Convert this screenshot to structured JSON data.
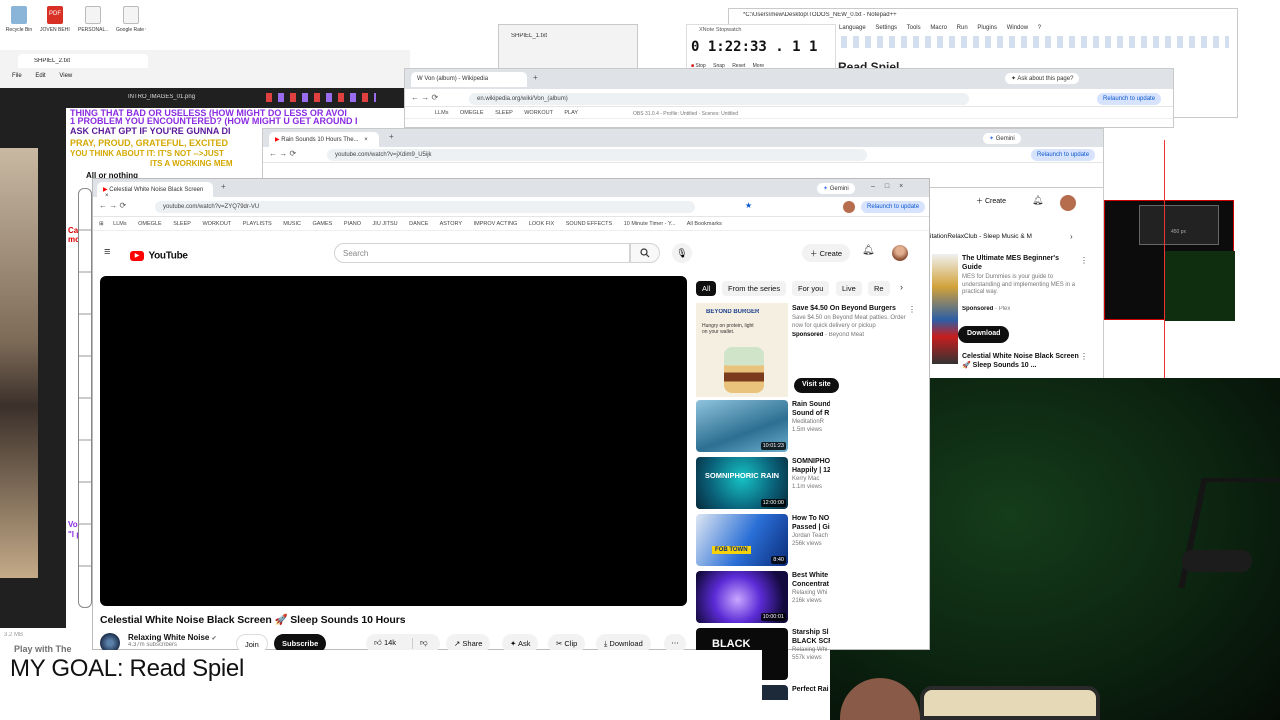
{
  "desktop": {
    "icons": [
      "Recycle Bin",
      "JOVEN BEHIND...",
      "PERSONAL...",
      "Google Rate Changelo..."
    ]
  },
  "notepad_plusplus": {
    "title": "*C:\\Users\\mew\\Desktop\\TODOS_NEW_0.txt - Notepad++",
    "menus": [
      "Language",
      "Settings",
      "Tools",
      "Macro",
      "Run",
      "Plugins",
      "Window",
      "?"
    ]
  },
  "stopwatch": {
    "title": "XNote Stopwatch",
    "time": "0 1:22:33 . 1 1",
    "buttons": [
      "Stop",
      "Snap",
      "Reset",
      "More"
    ],
    "caption": "Read Spiel"
  },
  "notepad_small": {
    "tab": "SHPIEL_1.txt",
    "menus": [
      "File",
      "Edit",
      "View"
    ]
  },
  "left_notepad": {
    "tab": "SHPIEL_2.txt",
    "menus": [
      "File",
      "Edit",
      "View"
    ],
    "status": "3.2 MB"
  },
  "image_viewer": {
    "filename": "INTRO_IMAGES_01.png",
    "lines": [
      "THING THAT BAD OR USELESS (HOW MIGHT DO LESS OR AVOI",
      "1 PROBLEM YOU ENCOUNTERED? (HOW MIGHT U GET AROUND I",
      "ASK CHAT GPT IF YOU'RE GUNNA DI",
      "PRAY, PROUD, GRATEFUL, EXCITED",
      "YOU THINK ABOUT IT: IT'S NOT -->JUST",
      "ITS A WORKING MEM"
    ],
    "all_or_nothing": "All or nothing",
    "side_fragments": [
      "Ca",
      "mc",
      "Voic",
      "\"I pre"
    ]
  },
  "wiki_window": {
    "tab": "Von (album) - Wikipedia",
    "url": "en.wikipedia.org/wiki/Von_(album)",
    "relaunch": "Relaunch to update",
    "ask": "Ask about this page?",
    "bookmarks": [
      "LLMs",
      "OMEGLE",
      "SLEEP",
      "WORKOUT",
      "PLAY"
    ],
    "obs_title": "OBS 31.0.4 - Profile: Untitled - Scenes: Untitled"
  },
  "rain_window": {
    "tab": "Rain Sounds 10 Hours The...",
    "url": "youtube.com/watch?v=jXdim9_U5ijk",
    "gemini": "Gemini",
    "relaunch": "Relaunch to update"
  },
  "right_youtube": {
    "create": "Create",
    "channel": "itationRelaxClub - Sleep Music & M",
    "ad_title": "The Ultimate MES Beginner's Guide",
    "ad_desc": "MES for Dummies is your guide to understanding and implementing MES in a practical way.",
    "ad_sponsor": "Sponsored",
    "ad_brand": "Plex",
    "download": "Download",
    "video_title": "Celestial White Noise Black Screen 🚀 Sleep Sounds 10 ...",
    "px_label": "450 px"
  },
  "main_window": {
    "tab": "Celestial White Noise Black Screen",
    "url": "youtube.com/watch?v=ZYQ79dr-VU",
    "gemini": "Gemini",
    "relaunch": "Relaunch to update",
    "bookmarks": [
      "LLMs",
      "OMEGLE",
      "SLEEP",
      "WORKOUT",
      "PLAYLISTS",
      "MUSIC",
      "GAMES",
      "PIANO",
      "JIU JITSU",
      "DANCE",
      "ASTORY",
      "IMPROV ACTING",
      "LOOK FIX",
      "SOUND EFFECTS",
      "10 Minute Timer - Y..."
    ],
    "all_bookmarks": "All Bookmarks"
  },
  "youtube": {
    "logo": "YouTube",
    "search_placeholder": "Search",
    "create": "Create",
    "video_title": "Celestial White Noise Black Screen 🚀 Sleep Sounds 10 Hours",
    "channel": "Relaxing White Noise",
    "verified": "✔",
    "subscribers": "4.37m subscribers",
    "join": "Join",
    "subscribe": "Subscribe",
    "likes": "14k",
    "share": "Share",
    "ask": "Ask",
    "clip": "Clip",
    "download": "Download",
    "chips": [
      "All",
      "From the series",
      "For you",
      "Live",
      "Re"
    ],
    "ad": {
      "title": "Save $4.50 On Beyond Burgers",
      "desc": "Save $4.50 on Beyond Meat patties. Order now for quick delivery or pickup",
      "sponsor": "Sponsored",
      "brand": "Beyond Meat",
      "visit": "Visit site",
      "thumb_brand": "BEYOND BURGER",
      "thumb_tagline": "Hungry on protein, light on your wallet."
    },
    "recs": [
      {
        "title": "Rain Sound",
        "title2": "Sound of R",
        "channel": "MeditationR",
        "views": "1.5m views",
        "duration": "10:01:23",
        "thumb_text": ""
      },
      {
        "title": "SOMNIPHO",
        "title2": "Happily | 12",
        "channel": "Kerry Mac",
        "views": "1.1m views",
        "duration": "12:00:00",
        "thumb_text": "SOMNIPHORIC RAIN"
      },
      {
        "title": "How To NO",
        "title2": "Passed | Gi",
        "channel": "Jordan Teach",
        "views": "256k views",
        "duration": "8:40",
        "thumb_text": "FOB TOWN"
      },
      {
        "title": "Best White",
        "title2": "Concentrat",
        "channel": "Relaxing Whi",
        "views": "216k views",
        "duration": "10:00:01",
        "thumb_text": ""
      },
      {
        "title": "Starship Sl",
        "title2": "BLACK SCR",
        "channel": "Relaxing Whi",
        "views": "557k views",
        "duration": "",
        "thumb_text": "BLACK SCREEN"
      },
      {
        "title": "Perfect Rai",
        "title2": "",
        "channel": "",
        "views": "",
        "duration": "",
        "thumb_text": ""
      }
    ]
  },
  "goal": {
    "text": "MY GOAL: Read Spiel",
    "behind": "Play with The"
  }
}
